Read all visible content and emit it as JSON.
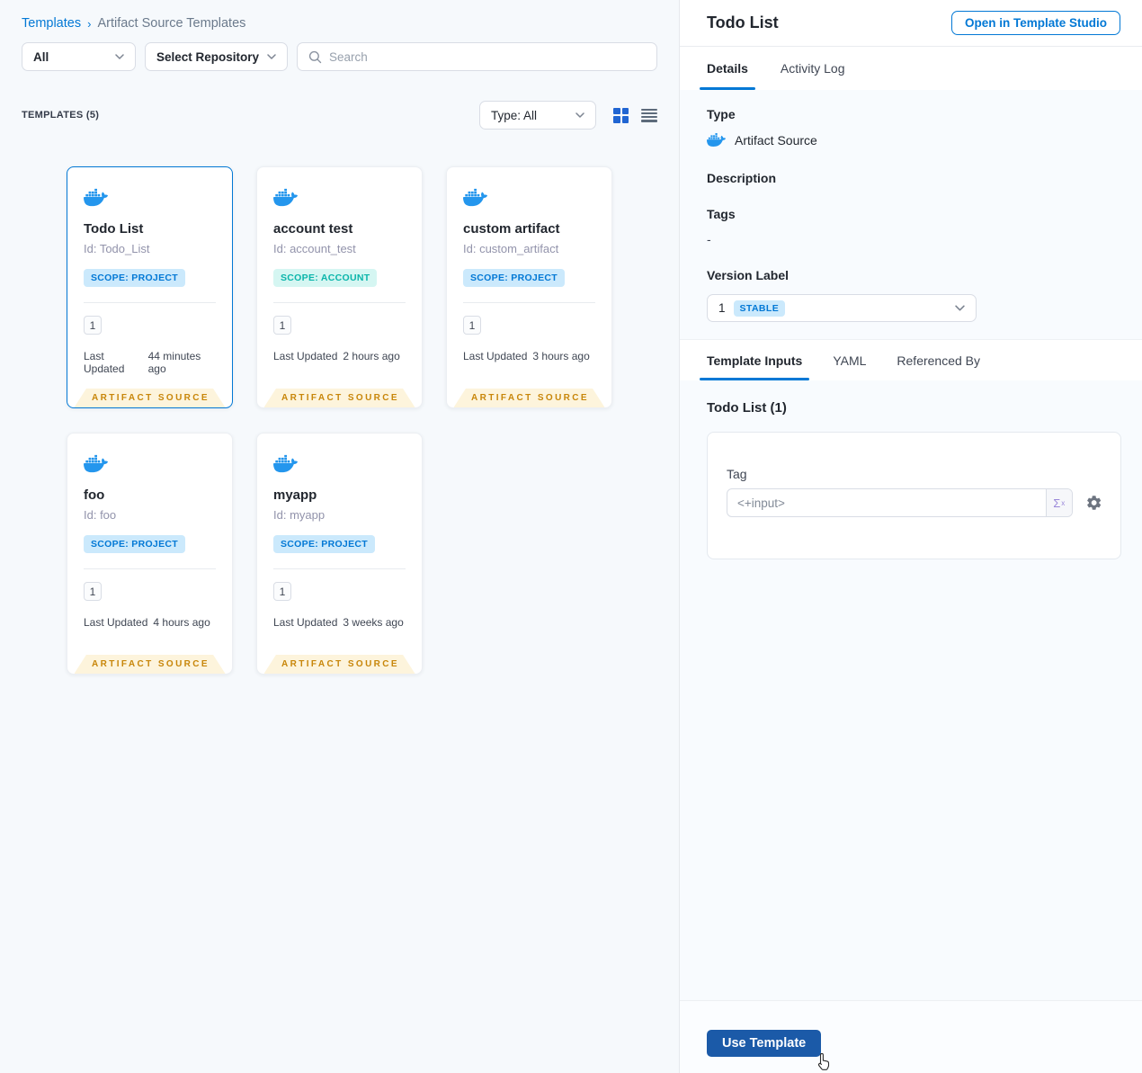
{
  "breadcrumb": {
    "root": "Templates",
    "separator": "›",
    "current": "Artifact Source Templates"
  },
  "filters": {
    "scope_dropdown": "All",
    "repo_dropdown": "Select Repository",
    "search_placeholder": "Search"
  },
  "templates_header": {
    "count_label": "TEMPLATES (5)",
    "type_dropdown": "Type: All"
  },
  "cards": [
    {
      "title": "Todo List",
      "id": "Id: Todo_List",
      "scope": "SCOPE: PROJECT",
      "scope_type": "project",
      "version": "1",
      "updated_label": "Last Updated",
      "updated": "44 minutes ago",
      "ribbon": "ARTIFACT SOURCE",
      "selected": true
    },
    {
      "title": "account test",
      "id": "Id: account_test",
      "scope": "SCOPE: ACCOUNT",
      "scope_type": "account",
      "version": "1",
      "updated_label": "Last Updated",
      "updated": "2 hours ago",
      "ribbon": "ARTIFACT SOURCE",
      "selected": false
    },
    {
      "title": "custom artifact",
      "id": "Id: custom_artifact",
      "scope": "SCOPE: PROJECT",
      "scope_type": "project",
      "version": "1",
      "updated_label": "Last Updated",
      "updated": "3 hours ago",
      "ribbon": "ARTIFACT SOURCE",
      "selected": false
    },
    {
      "title": "foo",
      "id": "Id: foo",
      "scope": "SCOPE: PROJECT",
      "scope_type": "project",
      "version": "1",
      "updated_label": "Last Updated",
      "updated": "4 hours ago",
      "ribbon": "ARTIFACT SOURCE",
      "selected": false
    },
    {
      "title": "myapp",
      "id": "Id: myapp",
      "scope": "SCOPE: PROJECT",
      "scope_type": "project",
      "version": "1",
      "updated_label": "Last Updated",
      "updated": "3 weeks ago",
      "ribbon": "ARTIFACT SOURCE",
      "selected": false
    }
  ],
  "panel": {
    "title": "Todo List",
    "open_button": "Open in Template Studio",
    "tabs": {
      "details": "Details",
      "activity_log": "Activity Log"
    },
    "details": {
      "type_label": "Type",
      "type_value": "Artifact Source",
      "description_label": "Description",
      "tags_label": "Tags",
      "tags_value": "-",
      "version_label": "Version Label",
      "version_value": "1",
      "version_badge": "STABLE"
    },
    "inner_tabs": {
      "template_inputs": "Template Inputs",
      "yaml": "YAML",
      "referenced_by": "Referenced By"
    },
    "inputs": {
      "section_title": "Todo List (1)",
      "tag_label": "Tag",
      "tag_value": "<+input>",
      "expression_icon": "Σ"
    },
    "footer": {
      "use_button": "Use Template"
    }
  },
  "icons": [
    "docker-whale-icon",
    "search-icon",
    "chevron-down-icon",
    "grid-view-icon",
    "list-view-icon",
    "gear-icon",
    "expression-sigma-icon",
    "hand-pointer-cursor"
  ],
  "colors": {
    "accent_blue": "#0278d5",
    "docker_blue": "#2496ed",
    "primary_button": "#1b5aa8",
    "scope_project_bg": "#cbe9fc",
    "scope_account_bg": "#d5f6f2",
    "scope_account_text": "#0ab5aa",
    "ribbon_bg": "#fdf4dc",
    "ribbon_text": "#c8860a",
    "page_bg": "#f6f9fc",
    "section_bg": "#f8fbfe"
  }
}
